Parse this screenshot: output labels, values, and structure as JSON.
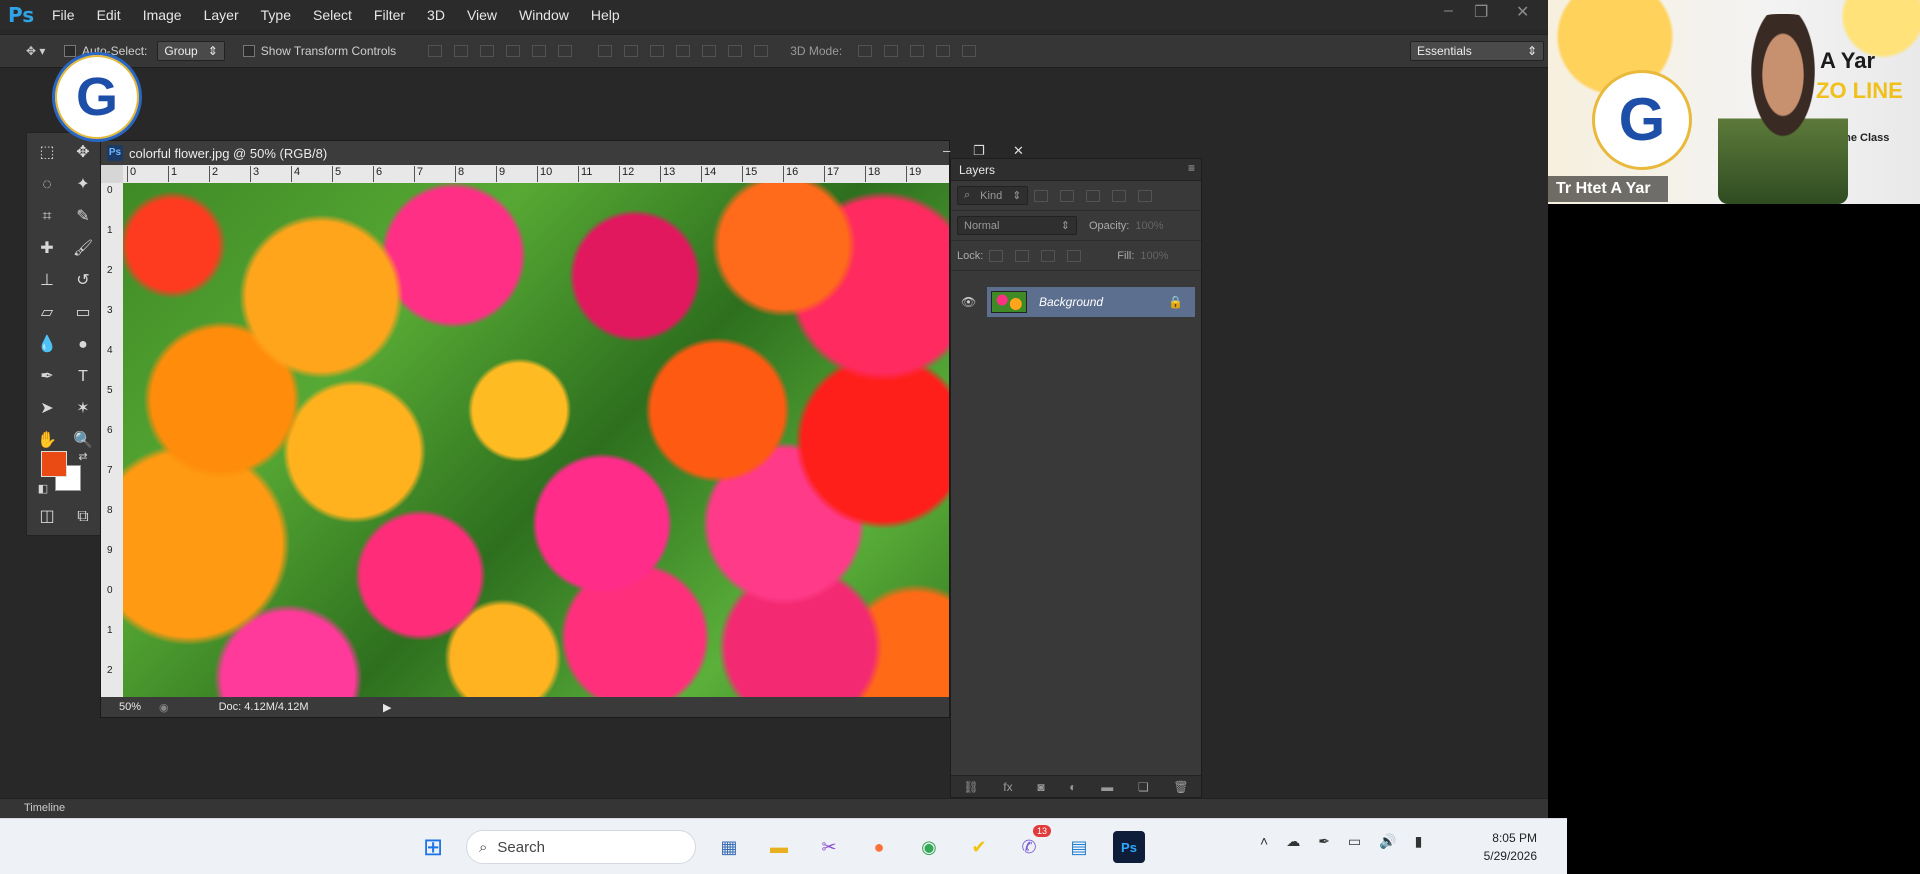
{
  "app": {
    "logo": "Ps",
    "menu": [
      "File",
      "Edit",
      "Image",
      "Layer",
      "Type",
      "Select",
      "Filter",
      "3D",
      "View",
      "Window",
      "Help"
    ]
  },
  "options_bar": {
    "auto_select_label": "Auto-Select:",
    "auto_select_value": "Group",
    "transform_label": "Show Transform Controls",
    "mode_label": "3D Mode:",
    "workspace": "Essentials"
  },
  "document": {
    "title": "colorful flower.jpg @ 50% (RGB/8)",
    "ruler_top": [
      "0",
      "1",
      "2",
      "3",
      "4",
      "5",
      "6",
      "7",
      "8",
      "9",
      "10",
      "11",
      "12",
      "13",
      "14",
      "15",
      "16",
      "17",
      "18",
      "19"
    ],
    "ruler_left": [
      "0",
      "1",
      "2",
      "3",
      "4",
      "5",
      "6",
      "7",
      "8",
      "9",
      "0",
      "1",
      "2"
    ],
    "zoom": "50%",
    "doc_info": "Doc: 4.12M/4.12M"
  },
  "layers": {
    "title": "Layers",
    "filter_kind": "Kind",
    "blend_mode": "Normal",
    "opacity_label": "Opacity:",
    "opacity_value": "100%",
    "lock_label": "Lock:",
    "fill_label": "Fill:",
    "fill_value": "100%",
    "items": [
      {
        "name": "Background",
        "locked": true,
        "visible": true
      }
    ]
  },
  "timeline_label": "Timeline",
  "webcam": {
    "logo_letter": "G",
    "brand_line1": "A Yar",
    "brand_line2": "ZO    LINE",
    "brand_sub": "line Class",
    "presenter": "Tr Htet A Yar"
  },
  "overlay_logo_letter": "G",
  "taskbar": {
    "search_placeholder": "Search",
    "notification_badge": "13",
    "time": "8:05 PM",
    "date": "5/29/2026"
  },
  "colors": {
    "foreground": "#ea4a14",
    "background": "#ffffff",
    "selected_layer": "#5c6f8f"
  }
}
